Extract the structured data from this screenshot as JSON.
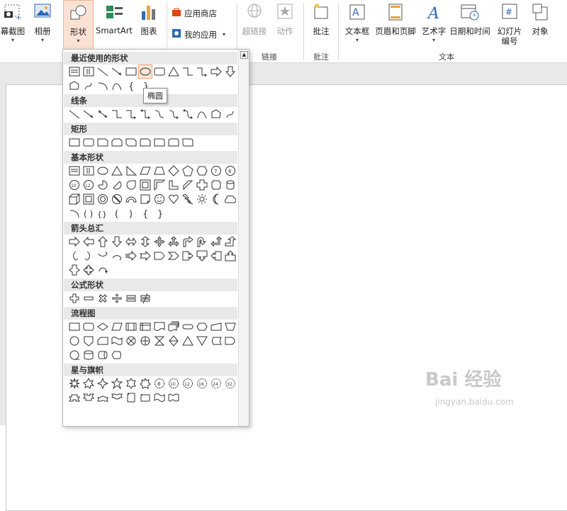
{
  "ribbon": {
    "screenshot": "幕截图",
    "album": "相册",
    "shapes": "形状",
    "smartart": "SmartArt",
    "chart": "图表",
    "app_store": "应用商店",
    "my_apps": "我的应用",
    "hyperlink": "超链接",
    "action": "动作",
    "comment": "批注",
    "textbox": "文本框",
    "header_footer": "页眉和页脚",
    "wordart": "艺术字",
    "datetime": "日期和时间",
    "slide_number_1": "幻灯片",
    "slide_number_2": "编号",
    "object": "对象",
    "group_links": "链接",
    "group_comments": "批注",
    "group_text": "文本"
  },
  "dropdown": {
    "sections": {
      "recent": "最近使用的形状",
      "lines": "线条",
      "rect": "矩形",
      "basic": "基本形状",
      "arrows": "箭头总汇",
      "equation": "公式形状",
      "flowchart": "流程图",
      "stars": "星与旗帜"
    }
  },
  "tooltip": "椭圆",
  "watermark": {
    "line1": "Bai 经验",
    "line2": "jingyan.baidu.com"
  }
}
